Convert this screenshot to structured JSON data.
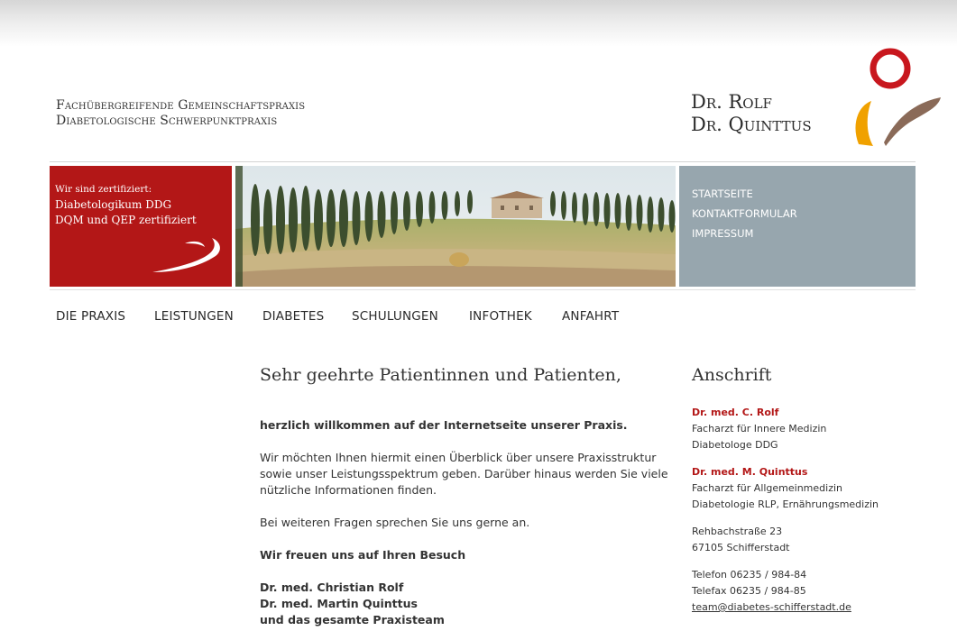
{
  "header": {
    "practice_line1": "Fachübergreifende Gemeinschaftspraxis",
    "practice_line2": "Diabetologische Schwerpunktpraxis",
    "logo_line1": "Dr. Rolf",
    "logo_line2": "Dr. Quinttus",
    "logo_colors": {
      "ring": "#c8171e",
      "swoosh_brown": "#8a6a58",
      "swoosh_orange": "#f0a100"
    }
  },
  "certificate": {
    "line1": "Wir sind zertifiziert:",
    "line2": "Diabetologikum DDG",
    "line3": "DQM und QEP zertifiziert",
    "bg_color": "#b31717"
  },
  "side_nav": {
    "bg_color": "#97a6ae",
    "items": [
      {
        "label": "STARTSEITE"
      },
      {
        "label": "KONTAKTFORMULAR"
      },
      {
        "label": "IMPRESSUM"
      }
    ]
  },
  "main_nav": {
    "items": [
      {
        "label": "DIE PRAXIS"
      },
      {
        "label": "LEISTUNGEN"
      },
      {
        "label": "DIABETES"
      },
      {
        "label": "SCHULUNGEN"
      },
      {
        "label": "INFOTHEK"
      },
      {
        "label": "ANFAHRT"
      }
    ]
  },
  "content": {
    "heading": "Sehr geehrte Patientinnen und Patienten,",
    "welcome": "herzlich willkommen auf der Internetseite unserer Praxis.",
    "intro": "Wir möchten Ihnen hiermit einen Überblick über unsere Praxisstruktur sowie unser Leistungsspektrum geben. Darüber hinaus werden Sie viele nützliche Informationen finden.",
    "questions": "Bei weiteren Fragen sprechen Sie uns gerne an.",
    "visit": "Wir freuen uns auf Ihren Besuch",
    "sign1": "Dr. med. Christian Rolf",
    "sign2": "Dr. med. Martin Quinttus",
    "sign3": "und das gesamte Praxisteam"
  },
  "address": {
    "heading": "Anschrift",
    "doc1_name": "Dr. med. C. Rolf",
    "doc1_line1": "Facharzt für Innere Medizin",
    "doc1_line2": "Diabetologe DDG",
    "doc2_name": "Dr. med. M. Quinttus",
    "doc2_line1": "Facharzt für Allgemeinmedizin",
    "doc2_line2": "Diabetologie RLP, Ernährungsmedizin",
    "street": "Rehbachstraße 23",
    "city": "67105 Schifferstadt",
    "phone": "Telefon 06235 / 984-84",
    "fax": "Telefax 06235 / 984-85",
    "email": "team@diabetes-schifferstadt.de"
  }
}
